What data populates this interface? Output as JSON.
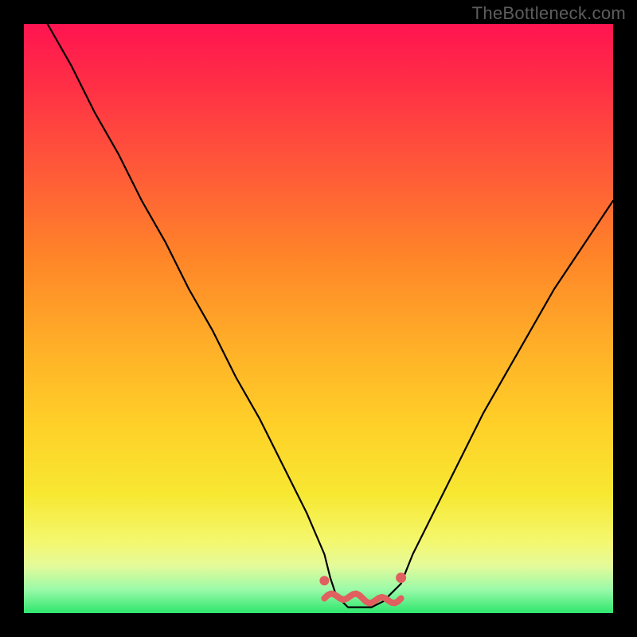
{
  "watermark": "TheBottleneck.com",
  "chart_data": {
    "type": "line",
    "title": "",
    "xlabel": "",
    "ylabel": "",
    "xlim": [
      0,
      100
    ],
    "ylim": [
      0,
      100
    ],
    "series": [
      {
        "name": "bottleneck-curve",
        "color": "#000000",
        "x": [
          0,
          4,
          8,
          12,
          16,
          20,
          24,
          28,
          32,
          36,
          40,
          44,
          48,
          51,
          52,
          53,
          55,
          57,
          59,
          61,
          64,
          66,
          70,
          74,
          78,
          82,
          86,
          90,
          94,
          98,
          100
        ],
        "y": [
          106,
          100,
          93,
          85,
          78,
          70,
          63,
          55,
          48,
          40,
          33,
          25,
          17,
          10,
          6,
          3,
          1,
          1,
          1,
          2,
          5,
          10,
          18,
          26,
          34,
          41,
          48,
          55,
          61,
          67,
          70
        ]
      },
      {
        "name": "optimal-band",
        "color": "#e06060",
        "type": "band",
        "x_range": [
          51,
          64
        ],
        "y_level": 2.5
      }
    ],
    "plot_background": {
      "type": "vertical-gradient",
      "stops": [
        {
          "pos": 0.0,
          "color": "#ff1450"
        },
        {
          "pos": 0.25,
          "color": "#ff5a38"
        },
        {
          "pos": 0.55,
          "color": "#ffb028"
        },
        {
          "pos": 0.8,
          "color": "#f7e832"
        },
        {
          "pos": 0.92,
          "color": "#e4fa9a"
        },
        {
          "pos": 1.0,
          "color": "#2ee66e"
        }
      ]
    }
  }
}
